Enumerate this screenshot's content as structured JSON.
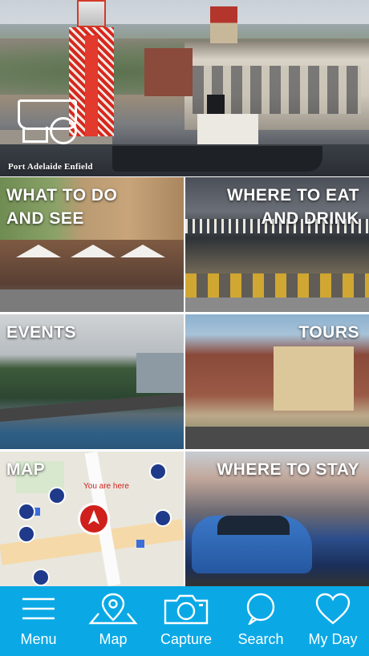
{
  "hero": {
    "brand_text": "Port Adelaide Enfield"
  },
  "tiles": [
    {
      "id": "what-to-do",
      "label": "WHAT TO DO\nAND SEE",
      "align": "left"
    },
    {
      "id": "where-to-eat",
      "label": "WHERE TO EAT\nAND DRINK",
      "align": "right"
    },
    {
      "id": "events",
      "label": "EVENTS",
      "align": "left"
    },
    {
      "id": "tours",
      "label": "TOURS",
      "align": "right"
    },
    {
      "id": "map",
      "label": "MAP",
      "align": "left"
    },
    {
      "id": "where-to-stay",
      "label": "WHERE TO STAY",
      "align": "right"
    }
  ],
  "map_preview": {
    "you_are_here": "You are here"
  },
  "tabbar": {
    "background": "#0aa9e6",
    "items": [
      {
        "label": "Menu",
        "icon": "hamburger-menu-icon"
      },
      {
        "label": "Map",
        "icon": "map-pin-icon"
      },
      {
        "label": "Capture",
        "icon": "camera-icon"
      },
      {
        "label": "Search",
        "icon": "search-bubble-icon"
      },
      {
        "label": "My Day",
        "icon": "heart-icon"
      }
    ]
  }
}
